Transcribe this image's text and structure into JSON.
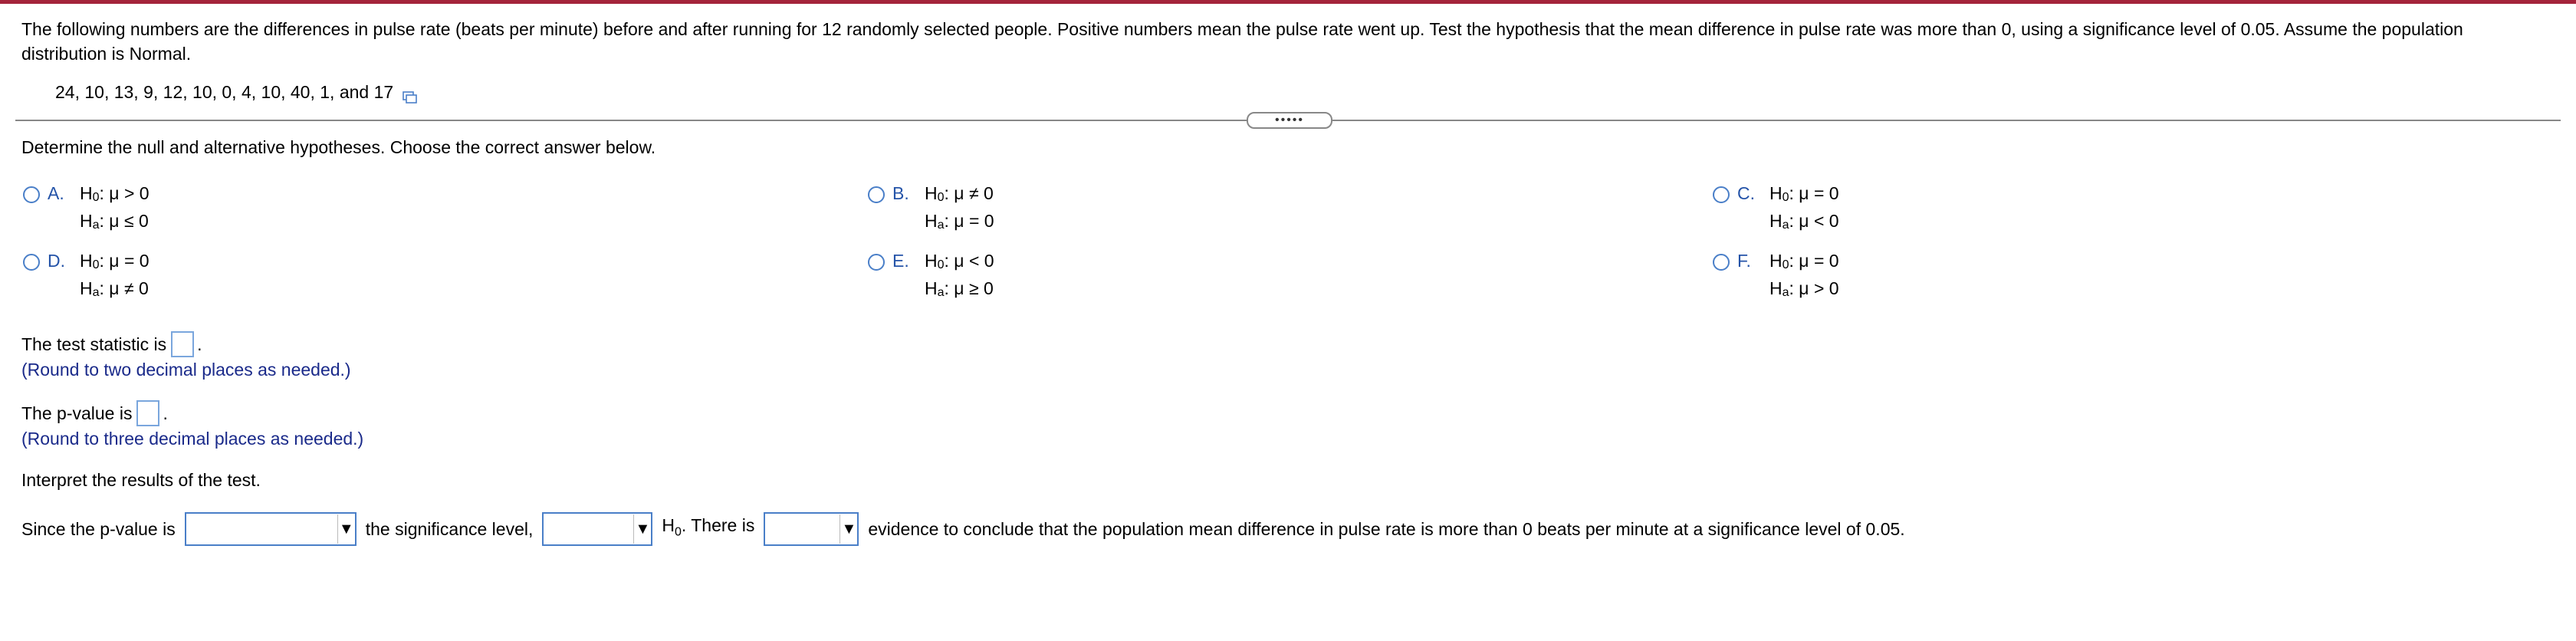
{
  "question": {
    "text": "The following numbers are the differences in pulse rate (beats per minute) before and after running for 12 randomly selected people. Positive numbers mean the pulse rate went up. Test the hypothesis that the mean difference in pulse rate was more than 0, using a significance level of 0.05. Assume the population distribution is Normal.",
    "data": "24, 10, 13, 9, 12, 10, 0, 4, 10, 40, 1, and 17",
    "copy_icon": "copy-data-icon"
  },
  "expand_handle": "•••••",
  "prompt1": "Determine the null and alternative hypotheses. Choose the correct answer below.",
  "choices": [
    {
      "letter": "A.",
      "h0_rel": ": μ > 0",
      "ha_rel": ": μ ≤ 0"
    },
    {
      "letter": "B.",
      "h0_rel": ": μ ≠ 0",
      "ha_rel": ": μ = 0"
    },
    {
      "letter": "C.",
      "h0_rel": ": μ = 0",
      "ha_rel": ": μ < 0"
    },
    {
      "letter": "D.",
      "h0_rel": ": μ = 0",
      "ha_rel": ": μ ≠ 0"
    },
    {
      "letter": "E.",
      "h0_rel": ": μ < 0",
      "ha_rel": ": μ ≥ 0"
    },
    {
      "letter": "F.",
      "h0_rel": ": μ = 0",
      "ha_rel": ": μ > 0"
    }
  ],
  "hyp_labels": {
    "H": "H",
    "sub0": "0",
    "suba": "a"
  },
  "test_statistic": {
    "label": "The test statistic is",
    "end": ".",
    "value": "",
    "note": "(Round to two decimal places as needed.)"
  },
  "p_value": {
    "label": "The p-value is",
    "end": ".",
    "value": "",
    "note": "(Round to three decimal places as needed.)"
  },
  "interpret": "Interpret the results of the test.",
  "conclusion": {
    "part1": "Since the p-value is",
    "part2": "the significance level,",
    "part3_H": "H",
    "part3_sub": "0",
    "part3_rest": ". There is",
    "part4": "evidence to conclude that the population mean difference in pulse rate is more than 0 beats per minute at a significance level of 0.05.",
    "dropdown1": "",
    "dropdown2": "",
    "dropdown3": "",
    "arrow": "▼"
  },
  "colors": {
    "accent_bar": "#a4243b",
    "link_blue": "#2453a8",
    "input_border": "#4a7fc8"
  }
}
